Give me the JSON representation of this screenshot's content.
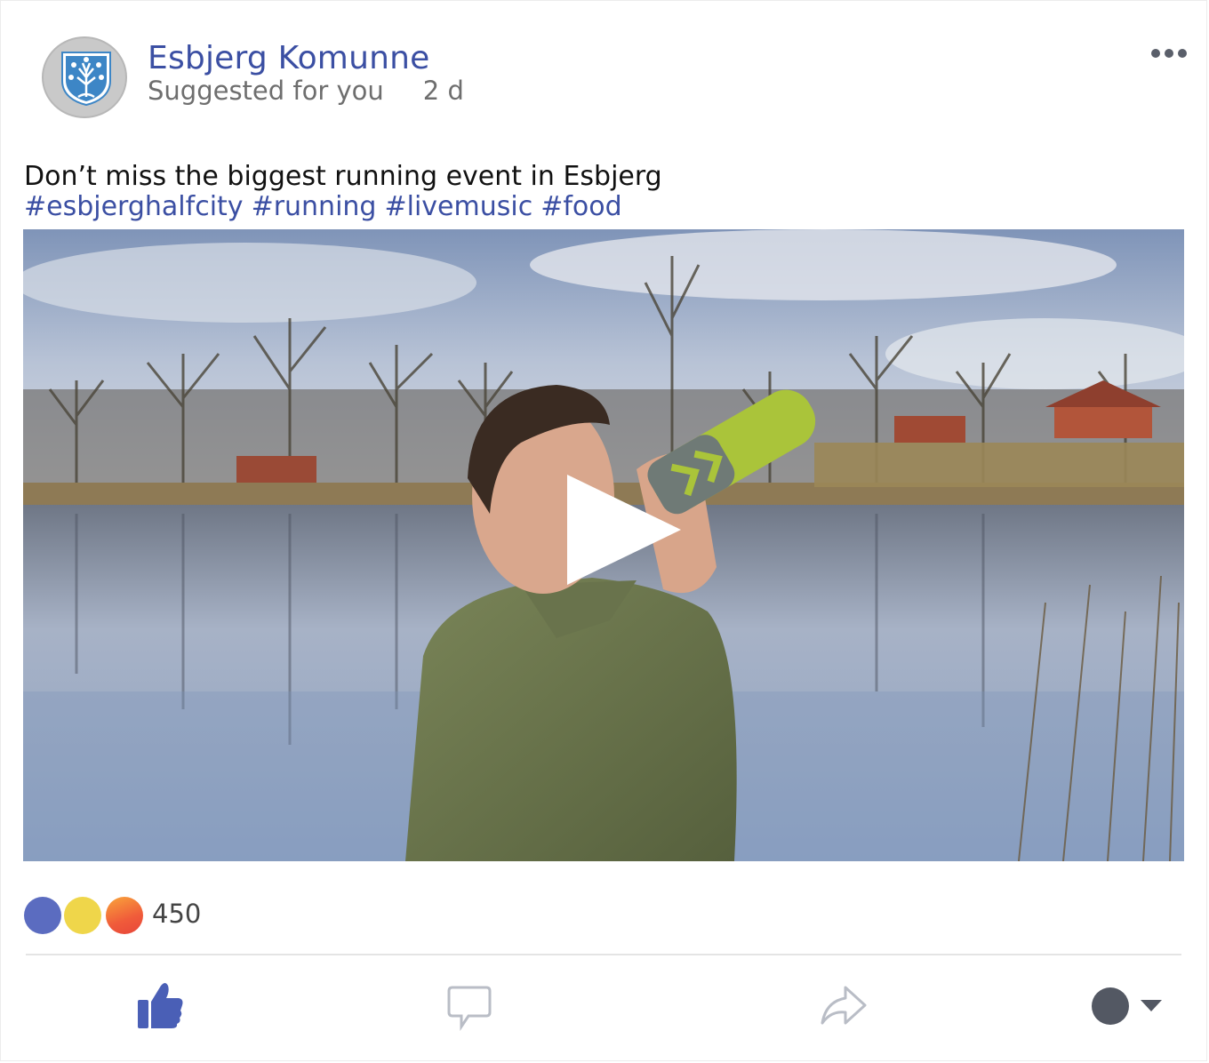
{
  "post": {
    "page_name": "Esbjerg Komunne",
    "subtitle": "Suggested for you",
    "time": "2 d",
    "text": "Don’t miss the biggest running event in Esbjerg",
    "hashtags": [
      "#esbjerghalfcity",
      "#running",
      "#livemusic",
      "#food"
    ]
  },
  "icons": {
    "avatar": "esbjerg-coat-of-arms-logo",
    "more": "more-options-icon",
    "play": "play-icon",
    "like": "thumbs-up-icon",
    "comment": "comment-bubble-icon",
    "share": "share-arrow-icon",
    "audience": "audience-selector-icon"
  },
  "reactions": {
    "count": "450",
    "types": [
      "like",
      "haha",
      "wow"
    ]
  },
  "colors": {
    "brand_blue": "#3b4fa3",
    "like_active": "#4a5fb6",
    "muted_icon": "#b9bdc6",
    "dark_icon": "#535863"
  }
}
